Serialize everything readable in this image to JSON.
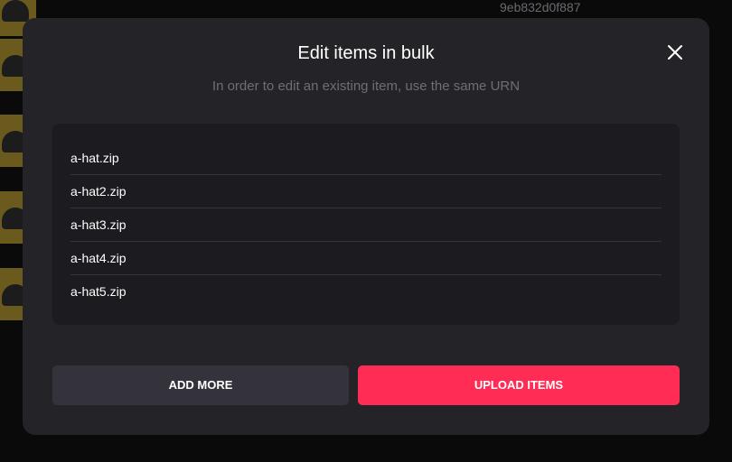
{
  "background": {
    "item_id": "9eb832d0f887"
  },
  "modal": {
    "title": "Edit items in bulk",
    "subtitle": "In order to edit an existing item, use the same URN",
    "files": [
      "a-hat.zip",
      "a-hat2.zip",
      "a-hat3.zip",
      "a-hat4.zip",
      "a-hat5.zip"
    ],
    "add_more_label": "ADD MORE",
    "upload_label": "UPLOAD ITEMS"
  },
  "colors": {
    "modal_bg": "#242328",
    "list_bg": "#1c1b20",
    "accent": "#ff2d55",
    "secondary_button": "#34333b"
  },
  "icons": {
    "close": "close-icon"
  }
}
